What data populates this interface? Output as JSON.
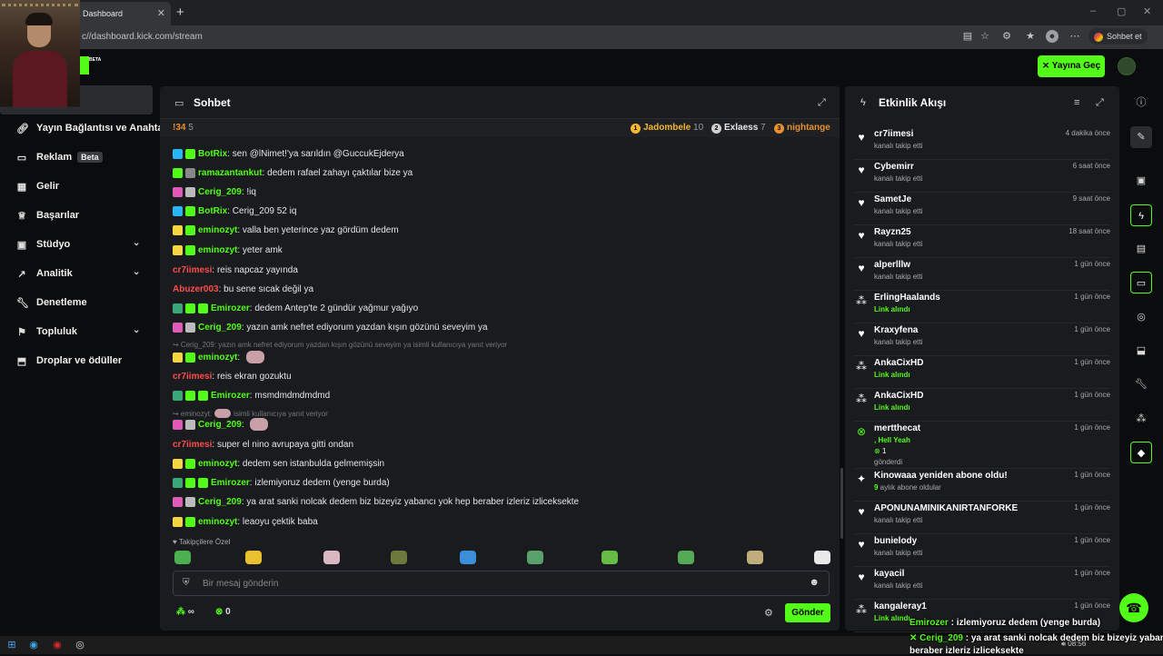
{
  "browser": {
    "tab_title": "k Dashboard",
    "url": "c//dashboard.kick.com/stream",
    "chat_button": "Sohbet et"
  },
  "header": {
    "beta_tag": "BETA",
    "go_live": "Yayına Geç"
  },
  "sidebar": {
    "items": [
      {
        "label": "Yayın Bağlantısı ve Anahta",
        "icon": "link-icon"
      },
      {
        "label": "Reklam",
        "badge": "Beta",
        "icon": "ad-icon"
      },
      {
        "label": "Gelir",
        "icon": "revenue-icon"
      },
      {
        "label": "Başarılar",
        "icon": "trophy-icon"
      },
      {
        "label": "Stüdyo",
        "icon": "studio-icon",
        "expandable": true
      },
      {
        "label": "Analitik",
        "icon": "analytics-icon",
        "expandable": true
      },
      {
        "label": "Denetleme",
        "icon": "wrench-icon"
      },
      {
        "label": "Topluluk",
        "icon": "community-icon",
        "expandable": true
      },
      {
        "label": "Droplar ve ödüller",
        "icon": "gift-icon"
      }
    ]
  },
  "chat": {
    "title": "Sohbet",
    "leaderboard": [
      {
        "rank": "",
        "name": "!34",
        "count": "5",
        "color": "#e8912d"
      },
      {
        "rank": "1",
        "name": "Jadombele",
        "count": "10",
        "color": "#f5b82e"
      },
      {
        "rank": "2",
        "name": "Exlaess",
        "count": "7",
        "color": "#e8e8e8"
      },
      {
        "rank": "3",
        "name": "nightangel",
        "count": "",
        "color": "#e8912d"
      }
    ],
    "messages": [
      {
        "user": "BotRix",
        "text": "sen @lNimet!'ya sarıldın @GuccukEjderya",
        "color": "#53fc18",
        "badges": [
          "#29b6f6",
          "#53fc18"
        ]
      },
      {
        "user": "ramazantankut",
        "text": "dedem rafael zahayı çaktılar bize ya",
        "color": "#53fc18",
        "badges": [
          "#53fc18",
          "#888888"
        ]
      },
      {
        "user": "Cerig_209",
        "text": "!iq",
        "color": "#53fc18",
        "badges": [
          "#e05ab8",
          "#bbbbbb"
        ]
      },
      {
        "user": "BotRix",
        "text": "Cerig_209 52 iq",
        "color": "#53fc18",
        "badges": [
          "#29b6f6",
          "#53fc18"
        ]
      },
      {
        "user": "eminozyt",
        "text": "valla ben yeterince yaz gördüm dedem",
        "color": "#53fc18",
        "badges": [
          "#f5d542",
          "#53fc18"
        ]
      },
      {
        "user": "eminozyt",
        "text": "yeter amk",
        "color": "#53fc18",
        "badges": [
          "#f5d542",
          "#53fc18"
        ]
      },
      {
        "user": "cr7iimesi",
        "text": "reis napcaz yayında",
        "color": "#ff4d4d",
        "badges": []
      },
      {
        "user": "Abuzer003",
        "text": "bu sene sıcak değil ya",
        "color": "#ff4d4d",
        "badges": []
      },
      {
        "user": "Emirozer",
        "text": "dedem Antep'te 2 gündür yağmur yağıyo",
        "color": "#53fc18",
        "badges": [
          "#3aa87a",
          "#53fc18",
          "#53fc18"
        ]
      },
      {
        "user": "Cerig_209",
        "text": "yazın amk nefret ediyorum yazdan kışın gözünü seveyim ya",
        "color": "#53fc18",
        "badges": [
          "#e05ab8",
          "#bbbbbb"
        ]
      },
      {
        "user": "eminozyt",
        "text": "",
        "color": "#53fc18",
        "badges": [
          "#f5d542",
          "#53fc18"
        ],
        "emote": true
      },
      {
        "user": "cr7iimesi",
        "text": "reis ekran gozuktu",
        "color": "#ff4d4d",
        "badges": []
      },
      {
        "user": "Emirozer",
        "text": "msmdmdmdmdmd",
        "color": "#53fc18",
        "badges": [
          "#3aa87a",
          "#53fc18",
          "#53fc18"
        ]
      },
      {
        "user": "Cerig_209",
        "text": "",
        "color": "#53fc18",
        "badges": [
          "#e05ab8",
          "#bbbbbb"
        ],
        "emote": true
      },
      {
        "user": "cr7iimesi",
        "text": "super el nino avrupaya gitti ondan",
        "color": "#ff4d4d",
        "badges": []
      },
      {
        "user": "eminozyt",
        "text": "dedem sen istanbulda gelmemişsin",
        "color": "#53fc18",
        "badges": [
          "#f5d542",
          "#53fc18"
        ]
      },
      {
        "user": "Emirozer",
        "text": "izlemiyoruz dedem (yenge burda)",
        "color": "#53fc18",
        "badges": [
          "#3aa87a",
          "#53fc18",
          "#53fc18"
        ]
      },
      {
        "user": "Cerig_209",
        "text": "ya arat sanki nolcak dedem biz bizeyiz yabancı yok hep beraber izleriz izliceksekte",
        "color": "#53fc18",
        "badges": [
          "#e05ab8",
          "#bbbbbb"
        ]
      },
      {
        "user": "eminozyt",
        "text": "leaoyu çektik baba",
        "color": "#53fc18",
        "badges": [
          "#f5d542",
          "#53fc18"
        ]
      }
    ],
    "reply1": "↪ Cerig_209: yazın amk nefret ediyorum yazdan kışın gözünü seveyim ya isimli kullanıcıya yanıt veriyor",
    "reply2_user": "↪ eminozyt:",
    "reply2_text": "isimli kullanıcıya yanıt veriyor",
    "followers_only": "♥ Takipçilere Özel",
    "input_placeholder": "Bir mesaj gönderin",
    "points": "∞",
    "kicks": "0",
    "send": "Gönder"
  },
  "activity": {
    "title": "Etkinlik Akışı",
    "items": [
      {
        "icon": "heart-icon",
        "name": "cr7iimesi",
        "desc": "kanalı takip etti",
        "time": "4 dakika önce"
      },
      {
        "icon": "heart-icon",
        "name": "Cybemirr",
        "desc": "kanalı takip etti",
        "time": "6 saat önce"
      },
      {
        "icon": "heart-icon",
        "name": "SametJe",
        "desc": "kanalı takip etti",
        "time": "9 saat önce"
      },
      {
        "icon": "heart-icon",
        "name": "Rayzn25",
        "desc": "kanalı takip etti",
        "time": "18 saat önce"
      },
      {
        "icon": "heart-icon",
        "name": "alperlllw",
        "desc": "kanalı takip etti",
        "time": "1 gün önce"
      },
      {
        "icon": "link-icon",
        "name": "ErlingHaalands",
        "desc": "Link alındı",
        "time": "1 gün önce",
        "green": true
      },
      {
        "icon": "heart-icon",
        "name": "Kraxyfena",
        "desc": "kanalı takip etti",
        "time": "1 gün önce"
      },
      {
        "icon": "link-icon",
        "name": "AnkaCixHD",
        "desc": "Link alındı",
        "time": "1 gün önce",
        "green": true
      },
      {
        "icon": "link-icon",
        "name": "AnkaCixHD",
        "desc": "Link alındı",
        "time": "1 gün önce",
        "green": true
      },
      {
        "icon": "kick-icon",
        "name": "mertthecat",
        "desc": ", Hell Yeah",
        "desc2": "1",
        "desc3": "gönderdi",
        "time": "1 gün önce",
        "green": true,
        "tall": true
      },
      {
        "icon": "star-icon",
        "name": "Kinowaaa yeniden abone oldu!",
        "desc": "9 aylık abone oldular",
        "time": "1 gün önce",
        "subgreen": "9"
      },
      {
        "icon": "heart-icon",
        "name": "APONUNAMINIKANIRTANFORKE",
        "desc": "kanalı takip etti",
        "time": "1 gün önce"
      },
      {
        "icon": "heart-icon",
        "name": "bunielody",
        "desc": "kanalı takip etti",
        "time": "1 gün önce"
      },
      {
        "icon": "heart-icon",
        "name": "kayacil",
        "desc": "kanalı takip etti",
        "time": "1 gün önce"
      },
      {
        "icon": "link-icon",
        "name": "kangaleray1",
        "desc": "Link alındı",
        "time": "1 gün önce",
        "green": true
      }
    ]
  },
  "overlay": [
    {
      "user": "Emirozer",
      "text": "izlemiyoruz dedem (yenge burda)"
    },
    {
      "user": "Cerig_209",
      "text": "ya arat sanki nolcak dedem biz bizeyiz yabancı yok"
    },
    {
      "user": "",
      "text": "beraber izleriz izliceksekte"
    }
  ],
  "taskbar": {
    "time": "08:56"
  }
}
